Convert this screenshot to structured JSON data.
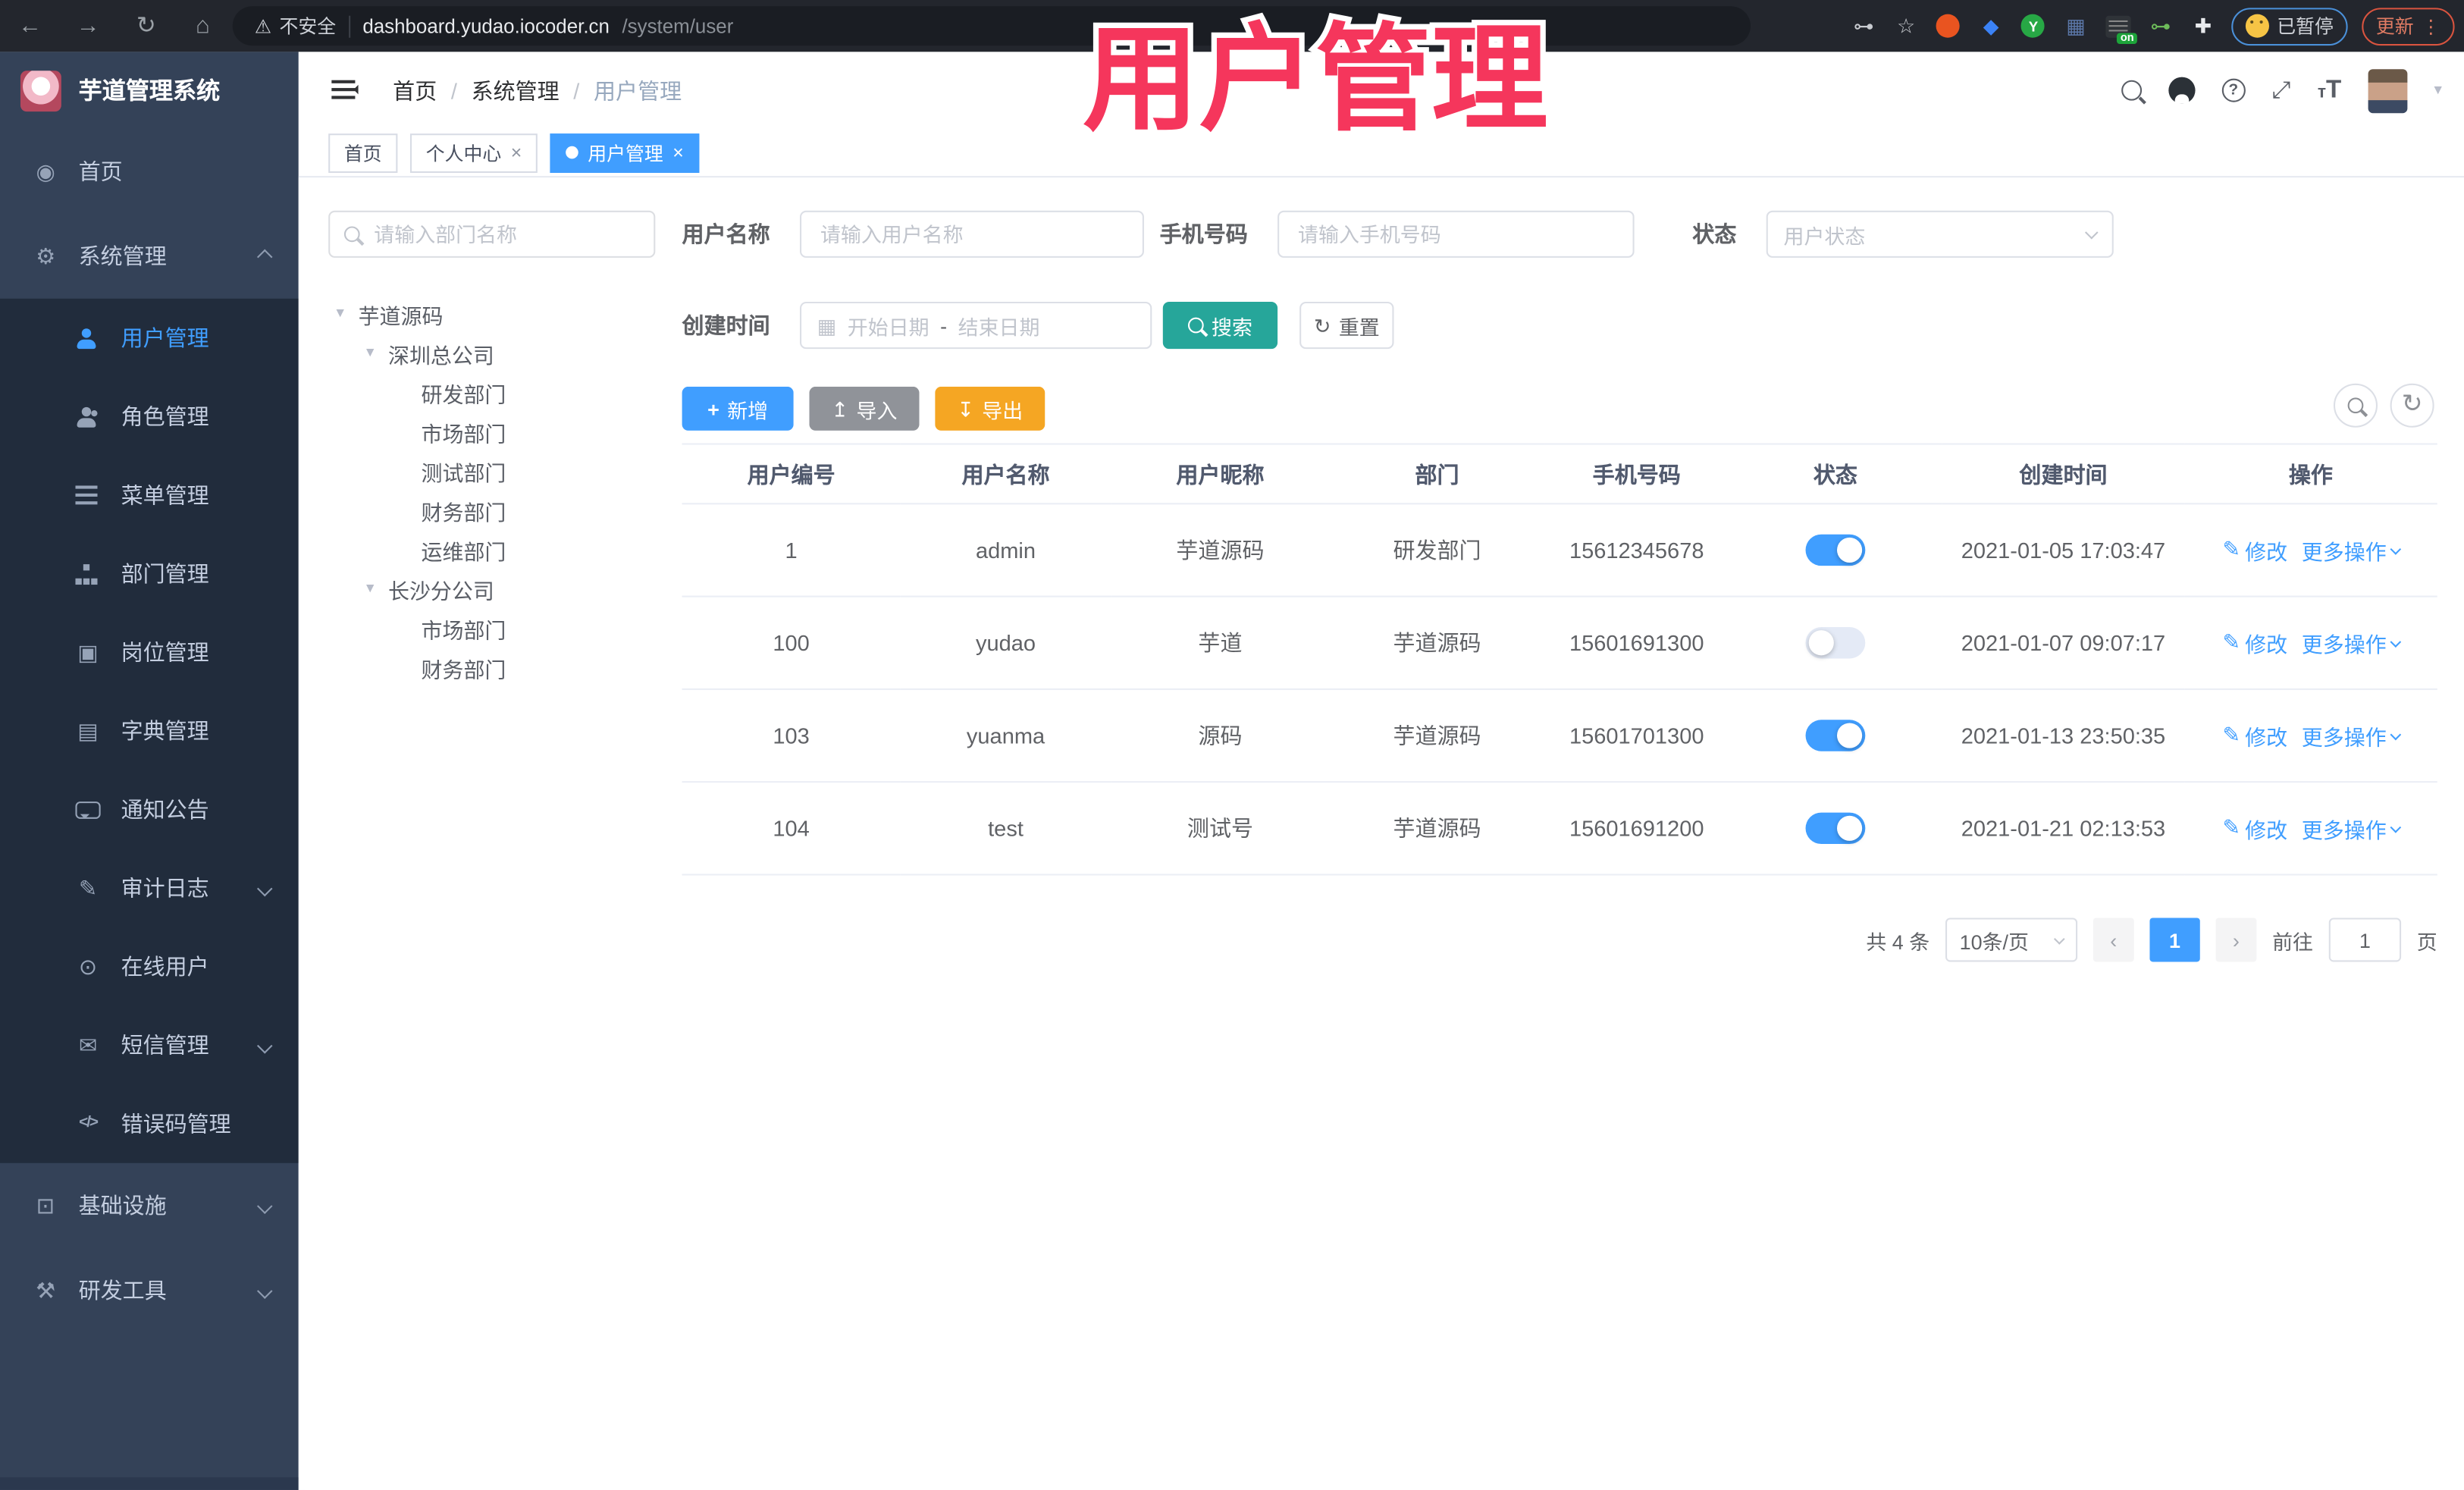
{
  "overlay": {
    "title": "用户管理",
    "color": "#f5365c"
  },
  "browser": {
    "security": "不安全",
    "url_host": "dashboard.yudao.iocoder.cn",
    "url_path": "/system/user",
    "ext_badge": "on",
    "ext_green_letter": "Y",
    "paused_badge": "已暂停",
    "update_button": "更新"
  },
  "logo": {
    "title": "芋道管理系统"
  },
  "breadcrumb": {
    "separator": "/",
    "items": [
      "首页",
      "系统管理",
      "用户管理"
    ]
  },
  "tags": [
    {
      "label": "首页",
      "closable": false,
      "active": false
    },
    {
      "label": "个人中心",
      "closable": true,
      "active": false
    },
    {
      "label": "用户管理",
      "closable": true,
      "active": true
    }
  ],
  "sidebar": {
    "items": [
      {
        "label": "首页",
        "icon": "dashboard-icon",
        "active": false
      },
      {
        "label": "系统管理",
        "icon": "gear-icon",
        "active": false,
        "expanded": true
      },
      {
        "label": "用户管理",
        "icon": "user-icon",
        "active": true
      },
      {
        "label": "角色管理",
        "icon": "users-icon",
        "active": false
      },
      {
        "label": "菜单管理",
        "icon": "list-icon",
        "active": false
      },
      {
        "label": "部门管理",
        "icon": "org-tree-icon",
        "active": false
      },
      {
        "label": "岗位管理",
        "icon": "badge-icon",
        "active": false
      },
      {
        "label": "字典管理",
        "icon": "dictionary-icon",
        "active": false
      },
      {
        "label": "通知公告",
        "icon": "announcement-icon",
        "active": false
      },
      {
        "label": "审计日志",
        "icon": "audit-log-icon",
        "active": false
      },
      {
        "label": "在线用户",
        "icon": "online-users-icon",
        "active": false
      },
      {
        "label": "短信管理",
        "icon": "sms-icon",
        "active": false
      },
      {
        "label": "错误码管理",
        "icon": "error-code-icon",
        "active": false
      },
      {
        "label": "基础设施",
        "icon": "infrastructure-icon",
        "active": false
      },
      {
        "label": "研发工具",
        "icon": "dev-tools-icon",
        "active": false
      }
    ]
  },
  "tree": {
    "search_placeholder": "请输入部门名称",
    "nodes": [
      {
        "label": "芋道源码",
        "level": 1,
        "expanded": true
      },
      {
        "label": "深圳总公司",
        "level": 2,
        "expanded": true
      },
      {
        "label": "研发部门",
        "level": 3
      },
      {
        "label": "市场部门",
        "level": 3
      },
      {
        "label": "测试部门",
        "level": 3
      },
      {
        "label": "财务部门",
        "level": 3
      },
      {
        "label": "运维部门",
        "level": 3
      },
      {
        "label": "长沙分公司",
        "level": 2,
        "expanded": true
      },
      {
        "label": "市场部门",
        "level": 3
      },
      {
        "label": "财务部门",
        "level": 3
      }
    ]
  },
  "filters": {
    "username_label": "用户名称",
    "username_placeholder": "请输入用户名称",
    "mobile_label": "手机号码",
    "mobile_placeholder": "请输入手机号码",
    "status_label": "状态",
    "status_placeholder": "用户状态",
    "created_label": "创建时间",
    "date_start_placeholder": "开始日期",
    "date_separator": "-",
    "date_end_placeholder": "结束日期",
    "search_button": "搜索",
    "reset_button": "重置"
  },
  "toolbar": {
    "add": "新增",
    "import": "导入",
    "export": "导出"
  },
  "table": {
    "columns": [
      "用户编号",
      "用户名称",
      "用户昵称",
      "部门",
      "手机号码",
      "状态",
      "创建时间",
      "操作"
    ],
    "rows": [
      {
        "id": "1",
        "username": "admin",
        "nickname": "芋道源码",
        "dept": "研发部门",
        "mobile": "15612345678",
        "status_on": true,
        "created": "2021-01-05 17:03:47",
        "edit": "修改",
        "more": "更多操作"
      },
      {
        "id": "100",
        "username": "yudao",
        "nickname": "芋道",
        "dept": "芋道源码",
        "mobile": "15601691300",
        "status_on": false,
        "created": "2021-01-07 09:07:17",
        "edit": "修改",
        "more": "更多操作"
      },
      {
        "id": "103",
        "username": "yuanma",
        "nickname": "源码",
        "dept": "芋道源码",
        "mobile": "15601701300",
        "status_on": true,
        "created": "2021-01-13 23:50:35",
        "edit": "修改",
        "more": "更多操作"
      },
      {
        "id": "104",
        "username": "test",
        "nickname": "测试号",
        "dept": "芋道源码",
        "mobile": "15601691200",
        "status_on": true,
        "created": "2021-01-21 02:13:53",
        "edit": "修改",
        "more": "更多操作"
      }
    ]
  },
  "pagination": {
    "total": "共 4 条",
    "page_size": "10条/页",
    "current": "1",
    "goto_label": "前往",
    "goto_value": "1",
    "page_label": "页"
  },
  "colors": {
    "accent": "#409eff",
    "search_teal": "#26a69a",
    "export_orange": "#f5a623",
    "import_gray": "#909399",
    "overlay_pink": "#f5365c",
    "sidebar_bg": "#344258",
    "submenu_bg": "#212c3c"
  }
}
